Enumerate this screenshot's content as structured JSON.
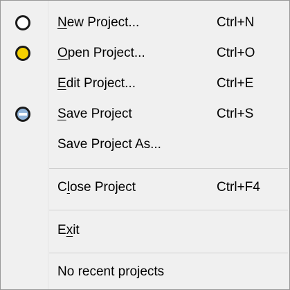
{
  "menu": {
    "items": [
      {
        "pre": "",
        "key": "N",
        "post": "ew Project...",
        "shortcut": "Ctrl+N",
        "icon": "new-project-icon"
      },
      {
        "pre": "",
        "key": "O",
        "post": "pen Project...",
        "shortcut": "Ctrl+O",
        "icon": "open-folder-icon"
      },
      {
        "pre": "",
        "key": "E",
        "post": "dit Project...",
        "shortcut": "Ctrl+E",
        "icon": ""
      },
      {
        "pre": "",
        "key": "S",
        "post": "ave Project",
        "shortcut": "Ctrl+S",
        "icon": "save-disk-icon"
      },
      {
        "pre": "Save Project As...",
        "key": "",
        "post": "",
        "shortcut": "",
        "icon": ""
      },
      {
        "pre": "C",
        "key": "l",
        "post": "ose Project",
        "shortcut": "Ctrl+F4",
        "icon": ""
      },
      {
        "pre": "E",
        "key": "x",
        "post": "it",
        "shortcut": "",
        "icon": ""
      },
      {
        "pre": "No recent projects",
        "key": "",
        "post": "",
        "shortcut": "",
        "icon": ""
      }
    ]
  },
  "colors": {
    "background": "#f0f0f0",
    "border": "#979797",
    "folder_yellow": "#f4d000",
    "disk_blue": "#8fb3d9"
  }
}
